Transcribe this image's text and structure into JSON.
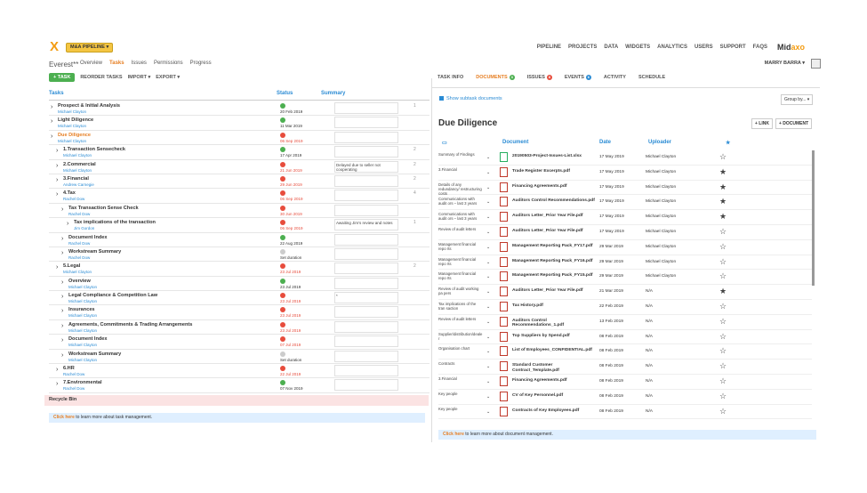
{
  "header": {
    "logo": "X",
    "pipeline_label": "M&A PIPELINE ▾",
    "nav": [
      "PIPELINE",
      "PROJECTS",
      "DATA",
      "WIDGETS",
      "ANALYTICS",
      "USERS",
      "SUPPORT",
      "FAQS"
    ],
    "brand": "Mid",
    "brand_accent": "axo",
    "user": "MARRY BARRA ▾"
  },
  "left": {
    "project": "Everest**",
    "tabs": [
      "Overview",
      "Tasks",
      "Issues",
      "Permissions",
      "Progress"
    ],
    "toolbar": {
      "add": "+ TASK",
      "reorder": "REORDER TASKS",
      "import": "IMPORT ▾",
      "export": "EXPORT ▾"
    },
    "headers": {
      "tasks": "Tasks",
      "status": "Status",
      "summary": "Summary"
    },
    "tasks": [
      {
        "name": "Prospect & Initial Analysis",
        "owner": "Michael Clayton",
        "date": "20 Feb 2019",
        "status": "g",
        "indent": 0,
        "summary": "",
        "note": "1"
      },
      {
        "name": "Light Diligence",
        "owner": "Michael Clayton",
        "date": "11 Mar 2019",
        "status": "g",
        "indent": 0,
        "summary": "",
        "note": ""
      },
      {
        "name": "Due Diligence",
        "owner": "Michael Clayton",
        "date": "06 Sep 2019",
        "status": "r",
        "indent": 0,
        "summary": "",
        "note": ""
      },
      {
        "name": "1.Transaction Sensecheck",
        "owner": "Michael Clayton",
        "date": "17 Apr 2019",
        "status": "g",
        "indent": 1,
        "summary": "",
        "note": "2"
      },
      {
        "name": "2.Commercial",
        "owner": "Michael Clayton",
        "date": "21 Jun 2019",
        "status": "r",
        "indent": 1,
        "summary": "Delayed due to seller not cooperating",
        "note": "2"
      },
      {
        "name": "3.Financial",
        "owner": "Andrew Carnegie",
        "date": "29 Jun 2019",
        "status": "r",
        "indent": 1,
        "summary": "",
        "note": "2"
      },
      {
        "name": "4.Tax",
        "owner": "Rachel Dow",
        "date": "06 Sep 2019",
        "status": "r",
        "indent": 1,
        "summary": "",
        "note": "4"
      },
      {
        "name": "Tax Transaction Sense Check",
        "owner": "Rachel Dow",
        "date": "30 Jun 2019",
        "status": "r",
        "indent": 2,
        "summary": "",
        "note": ""
      },
      {
        "name": "Tax implications of the transaction",
        "owner": "Jim Gordon",
        "date": "06 Sep 2019",
        "status": "r",
        "indent": 3,
        "summary": "Awaiting Jim's review and notes",
        "note": "1"
      },
      {
        "name": "Document Index",
        "owner": "Rachel Dow",
        "date": "22 Aug 2019",
        "status": "g",
        "indent": 2,
        "summary": "",
        "note": ""
      },
      {
        "name": "Workstream Summary",
        "owner": "Rachel Dow",
        "date": "Set duration",
        "status": "gr",
        "indent": 2,
        "summary": "",
        "note": ""
      },
      {
        "name": "5.Legal",
        "owner": "Michael Clayton",
        "date": "23 Jul 2019",
        "status": "r",
        "indent": 1,
        "summary": "",
        "note": "2"
      },
      {
        "name": "Overview",
        "owner": "Michael Clayton",
        "date": "23 Jul 2019",
        "status": "g",
        "indent": 2,
        "summary": "",
        "note": ""
      },
      {
        "name": "Legal Compliance & Competition Law",
        "owner": "Michael Clayton",
        "date": "23 Jul 2019",
        "status": "r",
        "indent": 2,
        "summary": "*",
        "note": ""
      },
      {
        "name": "Insurances",
        "owner": "Michael Clayton",
        "date": "23 Jul 2019",
        "status": "r",
        "indent": 2,
        "summary": "",
        "note": ""
      },
      {
        "name": "Agreements, Commitments & Trading Arrangements",
        "owner": "Michael Clayton",
        "date": "23 Jul 2019",
        "status": "r",
        "indent": 2,
        "summary": "",
        "note": ""
      },
      {
        "name": "Document Index",
        "owner": "Michael Clayton",
        "date": "07 Jul 2019",
        "status": "r",
        "indent": 2,
        "summary": "",
        "note": ""
      },
      {
        "name": "Workstream Summary",
        "owner": "Michael Clayton",
        "date": "Set duration",
        "status": "gr",
        "indent": 2,
        "summary": "",
        "note": ""
      },
      {
        "name": "6.HR",
        "owner": "Rachel Dow",
        "date": "22 Jul 2019",
        "status": "r",
        "indent": 1,
        "summary": "",
        "note": ""
      },
      {
        "name": "7.Environmental",
        "owner": "Rachel Dow",
        "date": "07 Nov 2019",
        "status": "g",
        "indent": 1,
        "summary": "",
        "note": ""
      }
    ],
    "recycle": "Recycle Bin",
    "info_link": "Click here",
    "info_text": " to learn more about task management."
  },
  "right": {
    "tabs": [
      {
        "label": "TASK INFO",
        "badge": ""
      },
      {
        "label": "DOCUMENTS",
        "badge": "3",
        "color": "#4caf50"
      },
      {
        "label": "ISSUES",
        "badge": "8",
        "color": "#e74c3c"
      },
      {
        "label": "EVENTS",
        "badge": "6",
        "color": "#2a8bd4"
      },
      {
        "label": "ACTIVITY",
        "badge": ""
      },
      {
        "label": "SCHEDULE",
        "badge": ""
      }
    ],
    "show_subtask": "Show subtask documents",
    "group_by": "Group by... ▾",
    "title": "Due Diligence",
    "link_btn": "+ LINK",
    "doc_btn": "+ DOCUMENT",
    "headers": {
      "doc": "Document",
      "date": "Date",
      "uploader": "Uploader"
    },
    "docs": [
      {
        "cat": "Summary of Findings",
        "file": "20190503-Project-Issues-List.xlsx",
        "date": "17 May 2019",
        "up": "Michael Clayton",
        "star": "☆",
        "x": true
      },
      {
        "cat": "3.Financial",
        "file": "Trade Register Excerpts.pdf",
        "date": "17 May 2019",
        "up": "Michael Clayton",
        "star": "★",
        "x": false
      },
      {
        "cat": "Details of any redundancy/ restructuring costs",
        "file": "Financing Agreements.pdf",
        "date": "17 May 2019",
        "up": "Michael Clayton",
        "star": "★",
        "x": false
      },
      {
        "cat": "Communications with audit ors – last 3 years",
        "file": "Auditors Control Recommendations.pdf",
        "date": "17 May 2019",
        "up": "Michael Clayton",
        "star": "★",
        "x": false
      },
      {
        "cat": "Communications with audit ors – last 3 years",
        "file": "Auditors Letter_Prior Year File.pdf",
        "date": "17 May 2019",
        "up": "Michael Clayton",
        "star": "★",
        "x": false
      },
      {
        "cat": "Review of audit letters",
        "file": "Auditors Letter_Prior Year File.pdf",
        "date": "17 May 2019",
        "up": "Michael Clayton",
        "star": "☆",
        "x": false
      },
      {
        "cat": "Management financial repo rts",
        "file": "Management Reporting Pack_FY17.pdf",
        "date": "29 Mar 2019",
        "up": "Michael Clayton",
        "star": "☆",
        "x": false
      },
      {
        "cat": "Management financial repo rts",
        "file": "Management Reporting Pack_FY16.pdf",
        "date": "29 Mar 2019",
        "up": "Michael Clayton",
        "star": "☆",
        "x": false
      },
      {
        "cat": "Management financial repo rts",
        "file": "Management Reporting Pack_FY15.pdf",
        "date": "29 Mar 2019",
        "up": "Michael Clayton",
        "star": "☆",
        "x": false
      },
      {
        "cat": "Review of audit working pa pers",
        "file": "Auditors Letter_Prior Year File.pdf",
        "date": "21 Mar 2019",
        "up": "N/A",
        "star": "★",
        "x": false
      },
      {
        "cat": "Tax implications of the tran saction",
        "file": "Tax History.pdf",
        "date": "22 Feb 2019",
        "up": "N/A",
        "star": "☆",
        "x": false
      },
      {
        "cat": "Review of audit letters",
        "file": "Auditors Control Recommendations_1.pdf",
        "date": "13 Feb 2019",
        "up": "N/A",
        "star": "☆",
        "x": false
      },
      {
        "cat": "Supplier/distribution/deale r",
        "file": "Top Suppliers by Spend.pdf",
        "date": "08 Feb 2019",
        "up": "N/A",
        "star": "☆",
        "x": false
      },
      {
        "cat": "Organisation chart",
        "file": "List of Employees_CONFIDENTIAL.pdf",
        "date": "08 Feb 2019",
        "up": "N/A",
        "star": "☆",
        "x": false
      },
      {
        "cat": "Contracts",
        "file": "Standard Customer Contract_Template.pdf",
        "date": "08 Feb 2019",
        "up": "N/A",
        "star": "☆",
        "x": false
      },
      {
        "cat": "3.Financial",
        "file": "Financing Agreements.pdf",
        "date": "08 Feb 2019",
        "up": "N/A",
        "star": "☆",
        "x": false
      },
      {
        "cat": "Key people",
        "file": "CV of Key Personnel.pdf",
        "date": "08 Feb 2019",
        "up": "N/A",
        "star": "☆",
        "x": false
      },
      {
        "cat": "Key people",
        "file": "Contracts of Key Employees.pdf",
        "date": "08 Feb 2019",
        "up": "N/A",
        "star": "☆",
        "x": false
      }
    ],
    "info_link": "Click here",
    "info_text": " to learn more about document management."
  }
}
